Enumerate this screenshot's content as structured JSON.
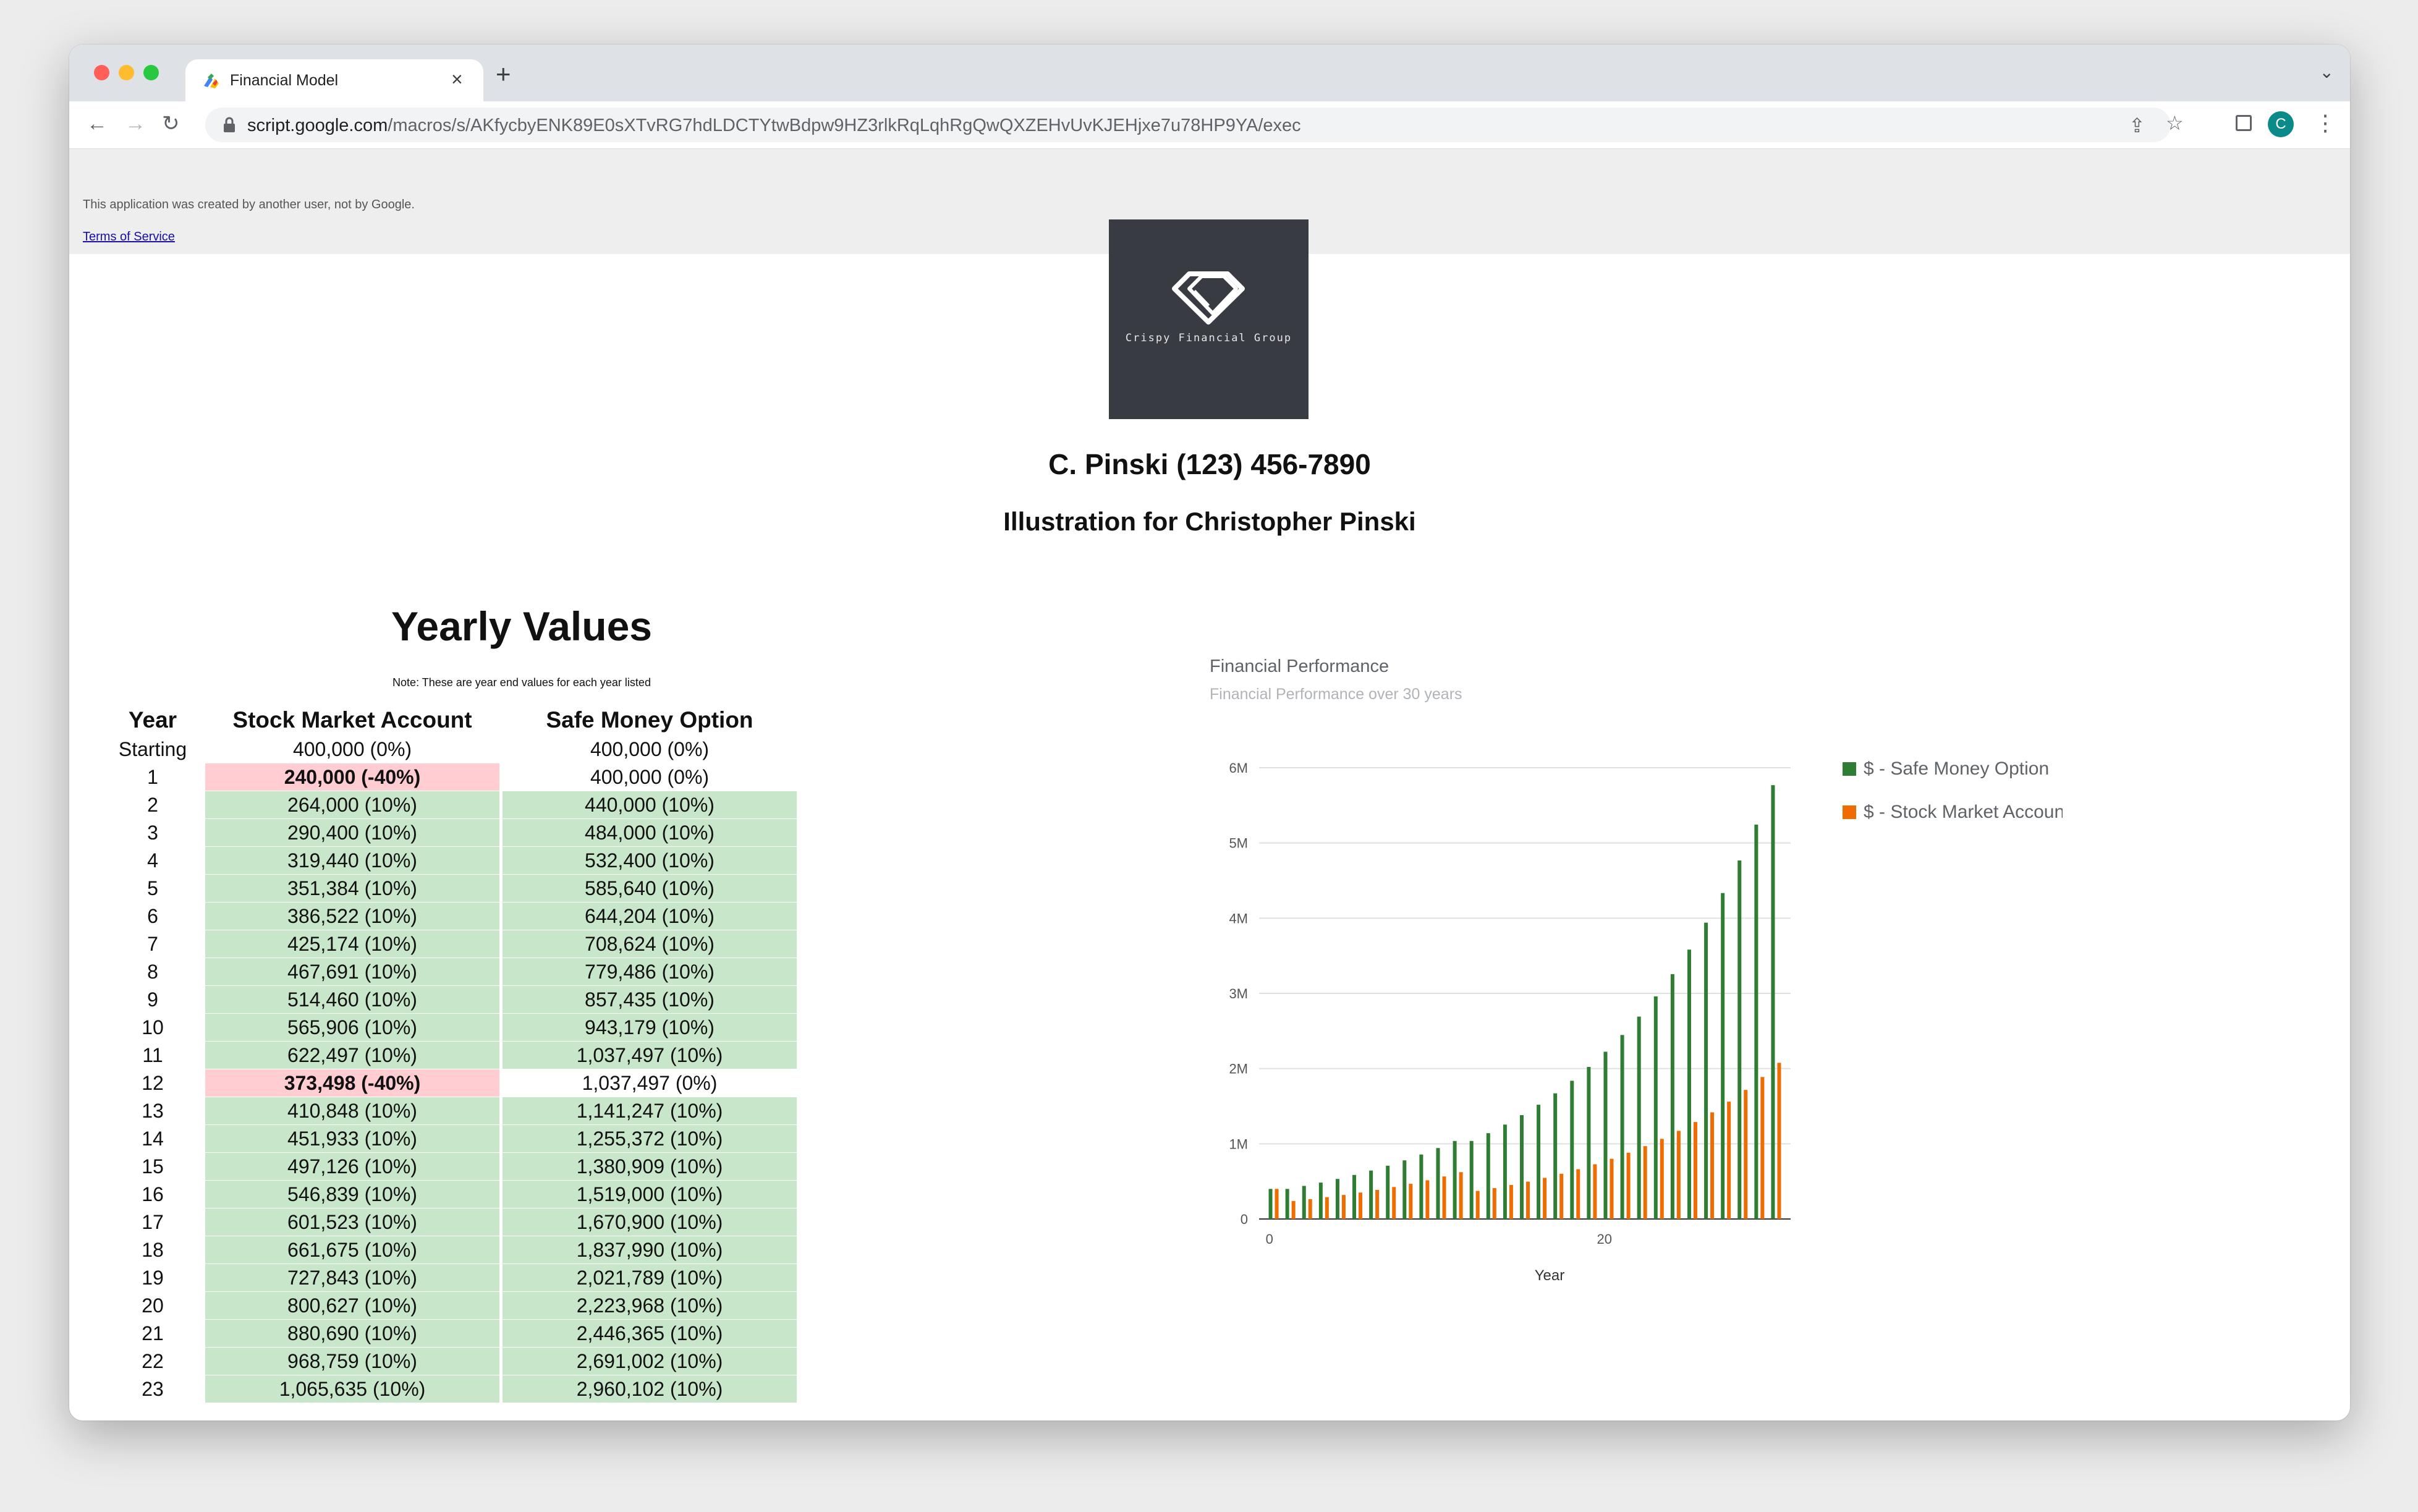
{
  "browser": {
    "tab_title": "Financial Model",
    "url_host": "script.google.com",
    "url_path": "/macros/s/AKfycbyENK89E0sXTvRG7hdLDCTYtwBdpw9HZ3rlkRqLqhRgQwQXZEHvUvKJEHjxe7u78HP9YA/exec",
    "profile_initial": "C",
    "icons": [
      "back-icon",
      "forward-icon",
      "reload-icon",
      "lock-icon",
      "share-icon",
      "star-icon",
      "side-panel-icon",
      "menu-icon"
    ]
  },
  "gas_banner": {
    "note": "This application was created by another user, not by Google.",
    "terms_link": "Terms of Service"
  },
  "logo": {
    "text": "Crispy Financial Group"
  },
  "header": {
    "contact": "C. Pinski (123) 456-7890",
    "illustration": "Illustration for Christopher Pinski"
  },
  "yearly": {
    "title": "Yearly Values",
    "note": "Note: These are year end values for each year listed",
    "headers": [
      "Year",
      "Stock Market Account",
      "Safe Money Option"
    ],
    "rows": [
      {
        "year": "Starting",
        "stock": "400,000 (0%)",
        "stock_style": "neutral",
        "safe": "400,000 (0%)",
        "safe_style": "neutral"
      },
      {
        "year": "1",
        "stock": "240,000 (-40%)",
        "stock_style": "neg",
        "safe": "400,000 (0%)",
        "safe_style": "neutral"
      },
      {
        "year": "2",
        "stock": "264,000 (10%)",
        "stock_style": "pos",
        "safe": "440,000 (10%)",
        "safe_style": "pos"
      },
      {
        "year": "3",
        "stock": "290,400 (10%)",
        "stock_style": "pos",
        "safe": "484,000 (10%)",
        "safe_style": "pos"
      },
      {
        "year": "4",
        "stock": "319,440 (10%)",
        "stock_style": "pos",
        "safe": "532,400 (10%)",
        "safe_style": "pos"
      },
      {
        "year": "5",
        "stock": "351,384 (10%)",
        "stock_style": "pos",
        "safe": "585,640 (10%)",
        "safe_style": "pos"
      },
      {
        "year": "6",
        "stock": "386,522 (10%)",
        "stock_style": "pos",
        "safe": "644,204 (10%)",
        "safe_style": "pos"
      },
      {
        "year": "7",
        "stock": "425,174 (10%)",
        "stock_style": "pos",
        "safe": "708,624 (10%)",
        "safe_style": "pos"
      },
      {
        "year": "8",
        "stock": "467,691 (10%)",
        "stock_style": "pos",
        "safe": "779,486 (10%)",
        "safe_style": "pos"
      },
      {
        "year": "9",
        "stock": "514,460 (10%)",
        "stock_style": "pos",
        "safe": "857,435 (10%)",
        "safe_style": "pos"
      },
      {
        "year": "10",
        "stock": "565,906 (10%)",
        "stock_style": "pos",
        "safe": "943,179 (10%)",
        "safe_style": "pos"
      },
      {
        "year": "11",
        "stock": "622,497 (10%)",
        "stock_style": "pos",
        "safe": "1,037,497 (10%)",
        "safe_style": "pos"
      },
      {
        "year": "12",
        "stock": "373,498 (-40%)",
        "stock_style": "neg",
        "safe": "1,037,497 (0%)",
        "safe_style": "neutral"
      },
      {
        "year": "13",
        "stock": "410,848 (10%)",
        "stock_style": "pos",
        "safe": "1,141,247 (10%)",
        "safe_style": "pos"
      },
      {
        "year": "14",
        "stock": "451,933 (10%)",
        "stock_style": "pos",
        "safe": "1,255,372 (10%)",
        "safe_style": "pos"
      },
      {
        "year": "15",
        "stock": "497,126 (10%)",
        "stock_style": "pos",
        "safe": "1,380,909 (10%)",
        "safe_style": "pos"
      },
      {
        "year": "16",
        "stock": "546,839 (10%)",
        "stock_style": "pos",
        "safe": "1,519,000 (10%)",
        "safe_style": "pos"
      },
      {
        "year": "17",
        "stock": "601,523 (10%)",
        "stock_style": "pos",
        "safe": "1,670,900 (10%)",
        "safe_style": "pos"
      },
      {
        "year": "18",
        "stock": "661,675 (10%)",
        "stock_style": "pos",
        "safe": "1,837,990 (10%)",
        "safe_style": "pos"
      },
      {
        "year": "19",
        "stock": "727,843 (10%)",
        "stock_style": "pos",
        "safe": "2,021,789 (10%)",
        "safe_style": "pos"
      },
      {
        "year": "20",
        "stock": "800,627 (10%)",
        "stock_style": "pos",
        "safe": "2,223,968 (10%)",
        "safe_style": "pos"
      },
      {
        "year": "21",
        "stock": "880,690 (10%)",
        "stock_style": "pos",
        "safe": "2,446,365 (10%)",
        "safe_style": "pos"
      },
      {
        "year": "22",
        "stock": "968,759 (10%)",
        "stock_style": "pos",
        "safe": "2,691,002 (10%)",
        "safe_style": "pos"
      },
      {
        "year": "23",
        "stock": "1,065,635 (10%)",
        "stock_style": "pos",
        "safe": "2,960,102 (10%)",
        "safe_style": "pos"
      }
    ]
  },
  "colors": {
    "positive_fill": "#c8e6c9",
    "negative_fill": "#ffcdd2",
    "safe_series": "#2e7d32",
    "stock_series": "#ef6c00"
  },
  "chart_data": {
    "type": "bar",
    "title": "Financial Performance",
    "subtitle": "Financial Performance over 30 years",
    "xlabel": "Year",
    "ylabel": "",
    "x_ticks": [
      "0",
      "20"
    ],
    "y_ticks": [
      "0",
      "1M",
      "2M",
      "3M",
      "4M",
      "5M",
      "6M"
    ],
    "ylim": [
      0,
      6000000
    ],
    "xlim": [
      0,
      30
    ],
    "legend_position": "right",
    "grid": true,
    "x": [
      0,
      1,
      2,
      3,
      4,
      5,
      6,
      7,
      8,
      9,
      10,
      11,
      12,
      13,
      14,
      15,
      16,
      17,
      18,
      19,
      20,
      21,
      22,
      23,
      24,
      25,
      26,
      27,
      28,
      29,
      30
    ],
    "series": [
      {
        "name": "$ - Safe Money Option",
        "values": [
          400000,
          400000,
          440000,
          484000,
          532400,
          585640,
          644204,
          708624,
          779486,
          857435,
          943179,
          1037497,
          1037497,
          1141247,
          1255372,
          1380909,
          1519000,
          1670900,
          1837990,
          2021789,
          2223968,
          2446365,
          2691002,
          2960102,
          3256112,
          3581723,
          3939896,
          4333885,
          4767274,
          5244001,
          5768401
        ]
      },
      {
        "name": "$ - Stock Market Account",
        "values": [
          400000,
          240000,
          264000,
          290400,
          319440,
          351384,
          386522,
          425174,
          467691,
          514460,
          565906,
          622497,
          373498,
          410848,
          451933,
          497126,
          546839,
          601523,
          661675,
          727843,
          800627,
          880690,
          968759,
          1065635,
          1172199,
          1289419,
          1418361,
          1560197,
          1716217,
          1887838,
          2076622
        ]
      }
    ]
  }
}
